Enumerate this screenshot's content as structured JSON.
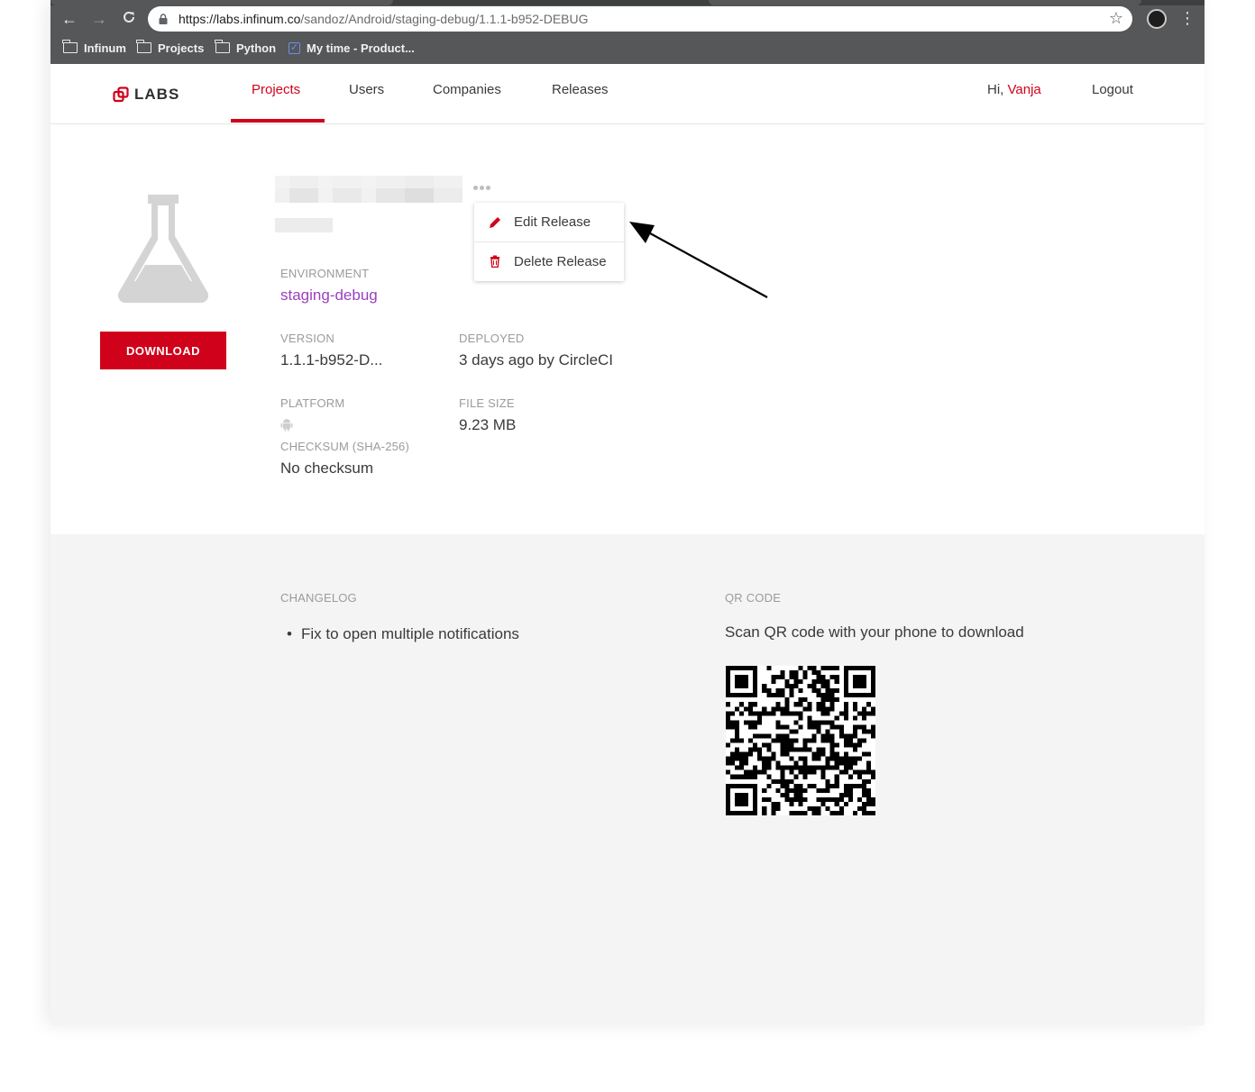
{
  "browser": {
    "url_host": "https://labs.infinum.co",
    "url_path": "/sandoz/Android/staging-debug/1.1.1-b952-DEBUG",
    "bookmarks": [
      {
        "label": "Infinum",
        "icon": "folder-icon"
      },
      {
        "label": "Projects",
        "icon": "folder-icon"
      },
      {
        "label": "Python",
        "icon": "folder-icon"
      },
      {
        "label": "My time - Product...",
        "icon": "checkbox-icon"
      }
    ]
  },
  "header": {
    "logo_text": "LABS",
    "nav": [
      {
        "label": "Projects",
        "active": true
      },
      {
        "label": "Users",
        "active": false
      },
      {
        "label": "Companies",
        "active": false
      },
      {
        "label": "Releases",
        "active": false
      }
    ],
    "greeting": "Hi,",
    "username": "Vanja",
    "logout": "Logout"
  },
  "release": {
    "download_label": "DOWNLOAD",
    "menu": {
      "edit": "Edit Release",
      "delete": "Delete Release"
    },
    "environment_label": "ENVIRONMENT",
    "environment": "staging-debug",
    "version_label": "VERSION",
    "version": "1.1.1-b952-D...",
    "deployed_label": "DEPLOYED",
    "deployed": "3 days ago by CircleCI",
    "platform_label": "PLATFORM",
    "platform_icon": "android-icon",
    "file_size_label": "FILE SIZE",
    "file_size": "9.23 MB",
    "checksum_label": "CHECKSUM (SHA-256)",
    "checksum": "No checksum"
  },
  "lower": {
    "changelog_label": "CHANGELOG",
    "changelog": [
      "Fix to open multiple notifications"
    ],
    "qr_label": "QR CODE",
    "qr_text": "Scan QR code with your phone to download"
  },
  "colors": {
    "brand_red": "#d0021b",
    "environment_purple": "#9b3fbf",
    "chrome_gray": "#555759",
    "panel_gray": "#f4f4f4"
  }
}
